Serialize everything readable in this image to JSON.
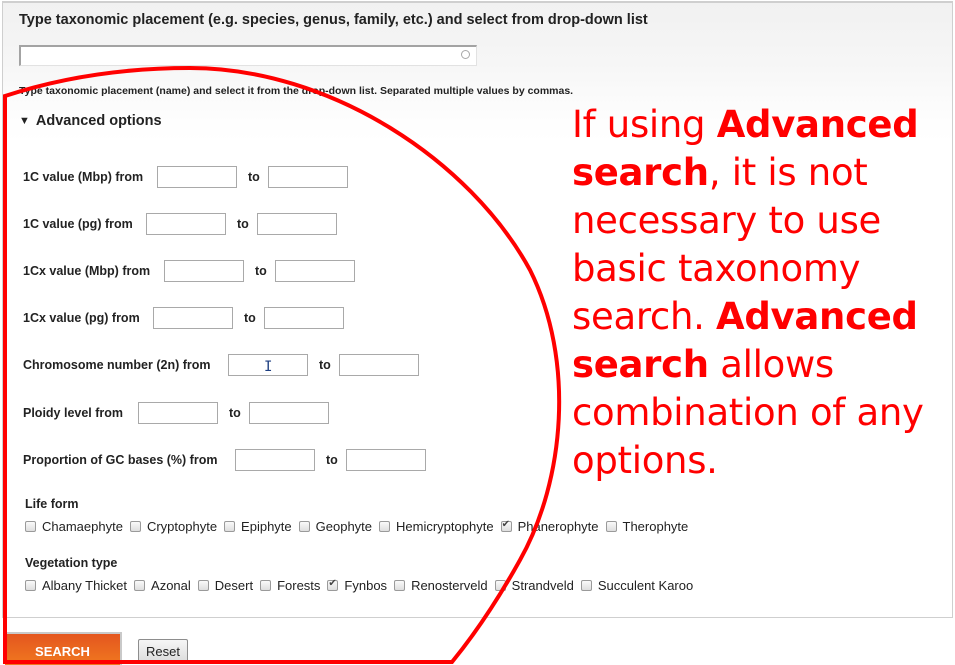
{
  "taxonomy": {
    "title": "Type taxonomic placement (e.g. species, genus, family, etc.) and select from drop-down list",
    "input_value": "",
    "help": "Type taxonomic placement (name) and select it from the drop-down list. Separated multiple values by commas."
  },
  "advanced": {
    "toggle_icon": "triangle-down-icon",
    "toggle_glyph": "▼",
    "toggle_label": "Advanced options",
    "to_label": "to",
    "ranges": [
      {
        "label": "1C value (Mbp) from",
        "from": "",
        "to": ""
      },
      {
        "label": "1C value (pg) from",
        "from": "",
        "to": ""
      },
      {
        "label": "1Cx value (Mbp) from",
        "from": "",
        "to": ""
      },
      {
        "label": "1Cx value (pg) from",
        "from": "",
        "to": ""
      },
      {
        "label": "Chromosome number (2n) from",
        "from": "",
        "to": ""
      },
      {
        "label": "Ploidy level from",
        "from": "",
        "to": ""
      },
      {
        "label": "Proportion of GC bases (%) from",
        "from": "",
        "to": ""
      }
    ],
    "life_form": {
      "title": "Life form",
      "options": [
        {
          "label": "Chamaephyte",
          "checked": false
        },
        {
          "label": "Cryptophyte",
          "checked": false
        },
        {
          "label": "Epiphyte",
          "checked": false
        },
        {
          "label": "Geophyte",
          "checked": false
        },
        {
          "label": "Hemicryptophyte",
          "checked": false
        },
        {
          "label": "Phanerophyte",
          "checked": true
        },
        {
          "label": "Therophyte",
          "checked": false
        }
      ]
    },
    "vegetation_type": {
      "title": "Vegetation type",
      "options": [
        {
          "label": "Albany Thicket",
          "checked": false
        },
        {
          "label": "Azonal",
          "checked": false
        },
        {
          "label": "Desert",
          "checked": false
        },
        {
          "label": "Forests",
          "checked": false
        },
        {
          "label": "Fynbos",
          "checked": true
        },
        {
          "label": "Renosterveld",
          "checked": false
        },
        {
          "label": "Strandveld",
          "checked": false
        },
        {
          "label": "Succulent Karoo",
          "checked": false
        }
      ]
    }
  },
  "buttons": {
    "search": "SEARCH",
    "reset": "Reset"
  },
  "annotation": {
    "color": "#ff0000",
    "parts": [
      {
        "text": "If using ",
        "bold": false
      },
      {
        "text": "Advanced search",
        "bold": true
      },
      {
        "text": ", it is not necessary to use basic taxonomy search. ",
        "bold": false
      },
      {
        "text": "Advanced search",
        "bold": true
      },
      {
        "text": " allows combination of any options.",
        "bold": false
      }
    ]
  }
}
